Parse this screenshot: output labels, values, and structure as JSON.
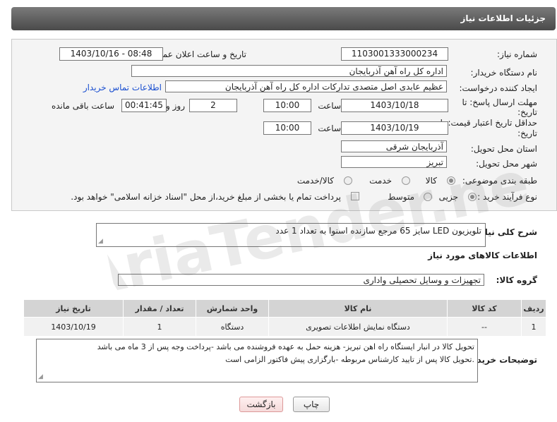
{
  "header": {
    "title": "جزئیات اطلاعات نیاز"
  },
  "fields": {
    "need_number_label": "شماره نیاز:",
    "need_number": "1103001333000234",
    "announce_label": "تاریخ و ساعت اعلان عمومی:",
    "announce_value": "1403/10/16 - 08:48",
    "buyer_org_label": "نام دستگاه خریدار:",
    "buyer_org": "اداره کل راه آهن آذربایجان",
    "creator_label": "ایجاد کننده درخواست:",
    "creator": "عظیم عابدی اصل متصدی تدارکات اداره کل راه آهن آذربایجان",
    "contact_link": "اطلاعات تماس خریدار",
    "deadline_label_1": "مهلت ارسال پاسخ: تا",
    "deadline_label_2": "تاریخ:",
    "deadline_date": "1403/10/18",
    "hour_label": "ساعت",
    "deadline_time": "10:00",
    "days_value": "2",
    "days_label": "روز و",
    "remaining_time": "00:41:45",
    "remaining_label": "ساعت باقی مانده",
    "validity_label_1": "حداقل تاریخ اعتبار قیمت: تا",
    "validity_label_2": "تاریخ:",
    "validity_date": "1403/10/19",
    "validity_time": "10:00",
    "province_label": "استان محل تحویل:",
    "province": "آذربایجان شرقی",
    "city_label": "شهر محل تحویل:",
    "city": "تبریز",
    "category_label": "طبقه بندی موضوعی:",
    "category_options": [
      "کالا",
      "خدمت",
      "کالا/خدمت"
    ],
    "process_label": "نوع فرآیند خرید :",
    "process_options": [
      "جزیی",
      "متوسط"
    ],
    "treasury_note": "پرداخت تمام یا بخشی از مبلغ خرید،از محل \"اسناد خزانه اسلامی\" خواهد بود."
  },
  "summary": {
    "label": "شرح کلی نیاز:",
    "text": "تلویزیون LED سایز 65 مرجع سازنده اسنوا به تعداد 1 عدد"
  },
  "goods_section": {
    "title": "اطلاعات کالاهای مورد نیاز",
    "group_label": "گروه کالا:",
    "group_value": "تجهیزات و وسایل تحصیلی واداری"
  },
  "table": {
    "headers": [
      "ردیف",
      "کد کالا",
      "نام کالا",
      "واحد شمارش",
      "تعداد / مقدار",
      "تاریخ نیاز"
    ],
    "rows": [
      [
        "1",
        "--",
        "دستگاه نمایش اطلاعات تصویری",
        "دستگاه",
        "1",
        "1403/10/19"
      ]
    ]
  },
  "buyer_notes": {
    "label": "توضیحات خریدار:",
    "line1": "تحویل کالا در انبار ایستگاه راه اهن تبریز- هزینه حمل به عهده  فروشنده می باشد -پرداخت وجه پس از 3 ماه می باشد",
    "line2": ".تحویل کالا پس از تایید کارشناس مربوطه -بارگزاری پیش فاکتور الزامی است"
  },
  "buttons": {
    "print": "چاپ",
    "back": "بازگشت"
  },
  "watermark": "AriaTender.net"
}
